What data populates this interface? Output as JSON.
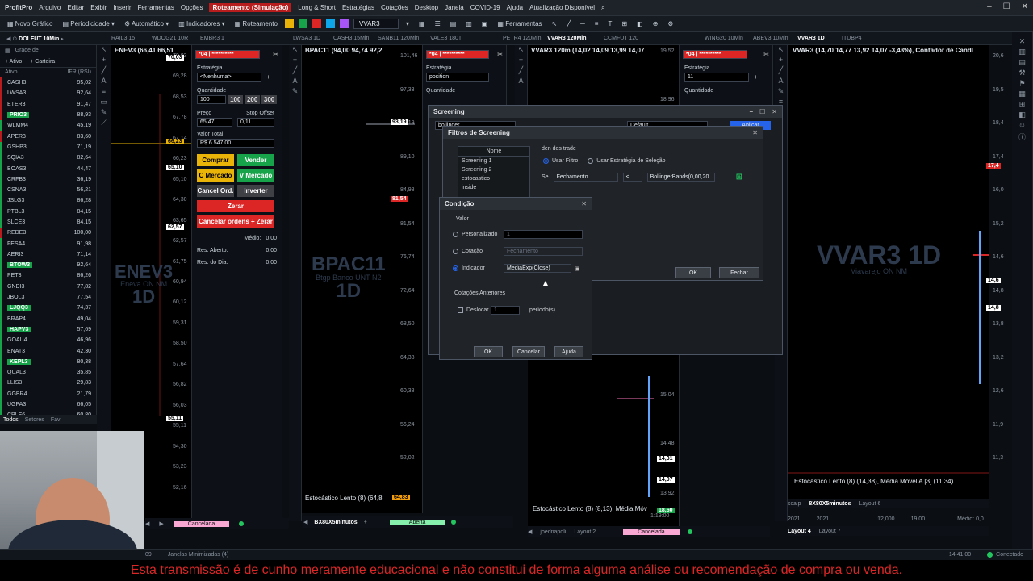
{
  "app": {
    "name": "ProfitPro",
    "menu": [
      "Arquivo",
      "Editar",
      "Exibir",
      "Inserir",
      "Ferramentas",
      "Opções"
    ],
    "sim_label": "Roteamento (Simulação)",
    "menu2": [
      "Long & Short",
      "Estratégias",
      "Cotações",
      "Desktop",
      "Janela",
      "COVID-19",
      "Ajuda",
      "Atualização Disponível"
    ]
  },
  "toolbar": {
    "novo_grafico": "Novo Gráfico",
    "periodicidade": "Periodicidade",
    "automatico": "Automático",
    "indicadores": "Indicadores",
    "roteamento": "Roteamento",
    "ticker": "VVAR3",
    "ferramentas": "Ferramentas"
  },
  "tabs": [
    "DOLFUT 10Min",
    "RAIL3 15",
    "WDOG21 10R",
    "EMBR3 1",
    "LWSA3 1D",
    "CASH3 15Min",
    "SANB11 120Min",
    "VALE3 180T",
    "PETR4 120Min",
    "VVAR3 120Min",
    "CCMFUT 120",
    "WING20 10Min",
    "ABEV3 10Min",
    "VVAR3 1D",
    "ITUBP4"
  ],
  "watchlist": {
    "header_grade": "Grade de",
    "ativo_tab": "Ativo",
    "carteira_tab": "Carteira",
    "col_ativo": "Ativo",
    "col_ifr": "IFR (RSI)",
    "rows": [
      {
        "sym": "CASH3",
        "val": "95,02",
        "hl": false,
        "bar": "r"
      },
      {
        "sym": "LWSA3",
        "val": "92,64",
        "hl": false,
        "bar": "r"
      },
      {
        "sym": "ETER3",
        "val": "91,47",
        "hl": false,
        "bar": "r"
      },
      {
        "sym": "PRIO3",
        "val": "88,93",
        "hl": true,
        "bar": "r"
      },
      {
        "sym": "WLMM4",
        "val": "45,19",
        "hl": false,
        "bar": "g"
      },
      {
        "sym": "APER3",
        "val": "83,60",
        "hl": false,
        "bar": "r"
      },
      {
        "sym": "GSHP3",
        "val": "71,19",
        "hl": false,
        "bar": "g"
      },
      {
        "sym": "SQIA3",
        "val": "82,64",
        "hl": false,
        "bar": "g"
      },
      {
        "sym": "BOAS3",
        "val": "44,47",
        "hl": false,
        "bar": "g"
      },
      {
        "sym": "CRFB3",
        "val": "36,19",
        "hl": false,
        "bar": "g"
      },
      {
        "sym": "CSNA3",
        "val": "56,21",
        "hl": false,
        "bar": "g"
      },
      {
        "sym": "JSLG3",
        "val": "86,28",
        "hl": false,
        "bar": "g"
      },
      {
        "sym": "PTBL3",
        "val": "84,15",
        "hl": false,
        "bar": "g"
      },
      {
        "sym": "SLCE3",
        "val": "84,15",
        "hl": false,
        "bar": "g"
      },
      {
        "sym": "REDE3",
        "val": "100,00",
        "hl": false,
        "bar": "r"
      },
      {
        "sym": "FESA4",
        "val": "91,98",
        "hl": false,
        "bar": "g"
      },
      {
        "sym": "AERI3",
        "val": "71,14",
        "hl": false,
        "bar": "g"
      },
      {
        "sym": "BTOW3",
        "val": "92,64",
        "hl": true,
        "bar": "g"
      },
      {
        "sym": "PET3",
        "val": "86,26",
        "hl": false,
        "bar": "g"
      },
      {
        "sym": "GNDI3",
        "val": "77,82",
        "hl": false,
        "bar": "g"
      },
      {
        "sym": "JBOL3",
        "val": "77,54",
        "hl": false,
        "bar": "g"
      },
      {
        "sym": "LJQQ3",
        "val": "74,37",
        "hl": true,
        "bar": "g"
      },
      {
        "sym": "BRAP4",
        "val": "49,04",
        "hl": false,
        "bar": "g"
      },
      {
        "sym": "HAPV3",
        "val": "57,69",
        "hl": true,
        "bar": "g"
      },
      {
        "sym": "GOAU4",
        "val": "46,96",
        "hl": false,
        "bar": "g"
      },
      {
        "sym": "ENAT3",
        "val": "42,30",
        "hl": false,
        "bar": "g"
      },
      {
        "sym": "KEPL3",
        "val": "80,38",
        "hl": true,
        "bar": "g"
      },
      {
        "sym": "QUAL3",
        "val": "35,85",
        "hl": false,
        "bar": "g"
      },
      {
        "sym": "LLIS3",
        "val": "29,83",
        "hl": false,
        "bar": "g"
      },
      {
        "sym": "GGBR4",
        "val": "21,79",
        "hl": false,
        "bar": "g"
      },
      {
        "sym": "UGPA3",
        "val": "66,05",
        "hl": false,
        "bar": "g"
      },
      {
        "sym": "CPLE6",
        "val": "60,80",
        "hl": false,
        "bar": "g"
      }
    ],
    "footer": [
      "Todos",
      "Setores",
      "Fav"
    ]
  },
  "chart1": {
    "title": "ENEV3 (66,41 66,51",
    "prices": [
      "70,03",
      "69,28",
      "68,53",
      "67,78",
      "67,14",
      "66,23",
      "65,10",
      "64,30",
      "63,65",
      "62,57",
      "61,75",
      "60,94",
      "60,12",
      "59,31",
      "58,50",
      "57,64",
      "56,82",
      "56,03",
      "55,11",
      "54,30",
      "53,23",
      "52,16"
    ],
    "badge_top": "70,03",
    "badge_mid": "66,23",
    "badge_low": "65,10",
    "badge_62": "62,57",
    "badge_55": "55,11",
    "wm_ticker": "ENEV3",
    "wm_sub": "Eneva ON NM",
    "wm_period": "1D"
  },
  "boleta1": {
    "account": "*04 | **********",
    "estrategia_label": "Estratégia",
    "estrategia_value": "<Nenhuma>",
    "quantidade_label": "Quantidade",
    "quantidade_value": "100",
    "qty_buttons": [
      "100",
      "200",
      "300"
    ],
    "preco_label": "Preço",
    "preco_value": "65,47",
    "stop_label": "Stop Offset",
    "stop_value": "0,11",
    "valor_label": "Valor Total",
    "valor_value": "R$ 6.547,00",
    "comprar": "Comprar",
    "vender": "Vender",
    "c_mercado": "C Mercado",
    "v_mercado": "V Mercado",
    "cancel_ord": "Cancel Ord.",
    "inverter": "Inverter",
    "zerar": "Zerar",
    "cancelar_zerar": "Cancelar ordens + Zerar",
    "medio_label": "Médio:",
    "medio_value": "0,00",
    "res_aberto_label": "Res. Aberto:",
    "res_aberto_value": "0,00",
    "res_dia_label": "Res. do Dia:",
    "res_dia_value": "0,00"
  },
  "chart2": {
    "title": "BPAC11 (94,00 94,74 92,2",
    "prices": [
      "101,46",
      "97,33",
      "93,19",
      "89,10",
      "84,98",
      "81,54",
      "76,74",
      "72,64",
      "68,50",
      "64,38",
      "60,38",
      "56,24",
      "52,02"
    ],
    "badge_93": "93,19",
    "badge_81": "81,54",
    "wm_ticker": "BPAC11",
    "wm_sub": "Btgp Banco UNT N2",
    "wm_period": "1D",
    "osc": "Estocástico Lento (8) (64,8",
    "osc_val": "64,83"
  },
  "boleta2": {
    "account": "*04 | **********",
    "estrategia_label": "Estratégia",
    "estrategia_value": "position",
    "quantidade_label": "Quantidade"
  },
  "chart3": {
    "title": "VVAR3 120m (14,02 14,09 13,99 14,07",
    "prices": [
      "19,52",
      "18,96",
      "15,04",
      "14,48",
      "14,31",
      "14,07",
      "13,92",
      "18,60"
    ],
    "badge_1431": "14,31",
    "badge_1407": "14,07",
    "badge_1860": "18,60",
    "osc": "Estocástico Lento (8) (8,13), Média Móv",
    "time": "1:19:00"
  },
  "boleta3": {
    "account": "*04 | **********",
    "estrategia_label": "Estratégia",
    "estrategia_value": "11",
    "quantidade_label": "Quantidade"
  },
  "chart4": {
    "title": "VVAR3 (14,70 14,77 13,92 14,07 -3,43%), Contador de Candl",
    "prices": [
      "20,6",
      "19,5",
      "18,4",
      "17,4",
      "16,0",
      "15,2",
      "14,6",
      "14,8",
      "13,8",
      "13,2",
      "12,6",
      "11,9",
      "11,3"
    ],
    "badge_174": "17,4",
    "badge_146": "14,6",
    "badge_148": "14,8",
    "wm_ticker": "VVAR3 1D",
    "wm_sub": "Viavarejo ON NM",
    "osc": "Estocástico Lento (8) (14,38), Média Móvel A [3] (11,34)",
    "x_labels": [
      "2021",
      "2021",
      "12,000",
      "19:00"
    ]
  },
  "screening": {
    "title": "Screening",
    "field1": "bollinger",
    "field2": "Default",
    "action": "Aplicar"
  },
  "filtros": {
    "title": "Filtros de Screening",
    "col_nome": "Nome",
    "items": [
      "Screening 1",
      "Screening 2",
      "estocastico",
      "inside"
    ],
    "dentro_label": "den dos trade",
    "usar_filtro": "Usar Filtro",
    "usar_estrategia": "Usar Estratégia de Seleção",
    "se_label": "Se",
    "se_field": "Fechamento",
    "op": "<",
    "cond_field": "BollingerBands(0,00,20",
    "ok": "OK",
    "fechar": "Fechar"
  },
  "condicao": {
    "title": "Condição",
    "valor_label": "Valor",
    "personalizado": "Personalizado",
    "personalizado_val": "1",
    "cotacao": "Cotação",
    "cotacao_val": "Fechamento",
    "indicador": "Indicador",
    "indicador_val": "MediaExp(Close)",
    "cot_ant_label": "Cotações Anteriores",
    "deslocar": "Deslocar",
    "deslocar_val": "1",
    "periodos": "período(s)",
    "ok": "OK",
    "cancelar": "Cancelar",
    "ajuda": "Ajuda"
  },
  "footers": {
    "layout1": "Cancelada",
    "layout2": "BX80X5minutos",
    "aberta": "Aberta",
    "joednapoli": "joednapoli",
    "layout2b": "Layout 2",
    "cancelada2": "Cancelada",
    "scalp": "scalp",
    "bx2": "8X80X5minutos",
    "layout6": "Layout 6",
    "layout4": "Layout 4",
    "layout7": "Layout 7",
    "medio": "Médio: 0,0"
  },
  "status": {
    "janelas": "Janelas Minimizadas (4)",
    "left": "09",
    "time": "14:41:00",
    "conectado": "Conectado"
  },
  "disclaimer": "Esta transmissão é de cunho meramente educacional e não constitui de forma alguma análise ou recomendação de compra ou venda."
}
